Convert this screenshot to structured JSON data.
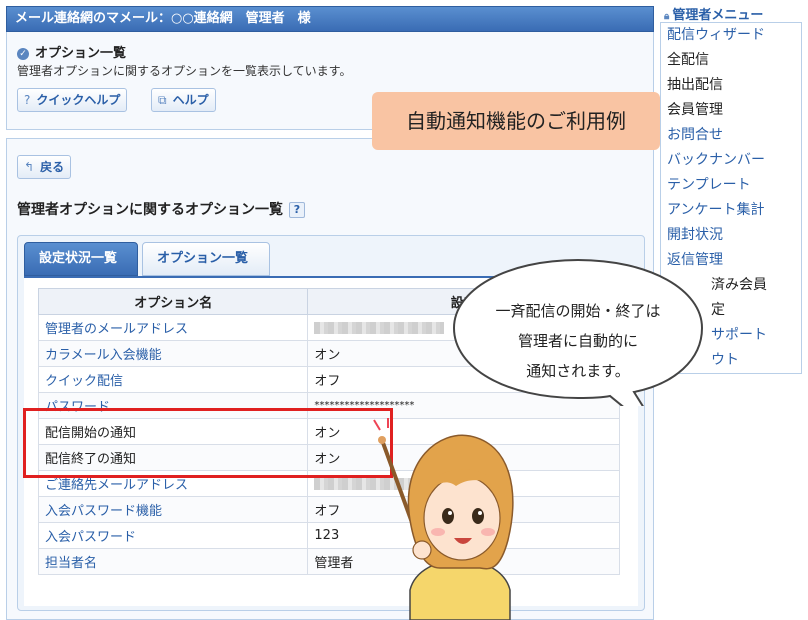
{
  "header": {
    "title": "メール連絡網のマメール：○○連絡網　管理者　様"
  },
  "summary": {
    "title": "オプション一覧",
    "description": "管理者オプションに関するオプションを一覧表示しています。",
    "quick_help_label": "クイックヘルプ",
    "help_label": "ヘルプ"
  },
  "callout": {
    "label": "自動通知機能のご利用例"
  },
  "main": {
    "back_label": "戻る",
    "section_title": "管理者オプションに関するオプション一覧",
    "tabs": [
      {
        "label": "設定状況一覧",
        "active": true
      },
      {
        "label": "オプション一覧",
        "active": false
      }
    ],
    "table": {
      "headers": [
        "オプション名",
        "設定"
      ],
      "rows": [
        {
          "name": "管理者のメールアドレス",
          "value": "",
          "blurred": true,
          "link": true
        },
        {
          "name": "カラメール入会機能",
          "value": "オン",
          "link": true
        },
        {
          "name": "クイック配信",
          "value": "オフ",
          "link": true
        },
        {
          "name": "パスワード",
          "value": "********************",
          "link": true
        },
        {
          "name": "配信開始の通知",
          "value": "オン",
          "link": false
        },
        {
          "name": "配信終了の通知",
          "value": "オン",
          "link": false
        },
        {
          "name": "ご連絡先メールアドレス",
          "value": "",
          "blurred": true,
          "link": true
        },
        {
          "name": "入会パスワード機能",
          "value": "オフ",
          "link": true
        },
        {
          "name": "入会パスワード",
          "value": "123",
          "link": true
        },
        {
          "name": "担当者名",
          "value": "管理者",
          "link": true
        }
      ]
    }
  },
  "menu": {
    "title": "管理者メニュー",
    "items": [
      {
        "label": "配信ウィザード",
        "link": true
      },
      {
        "label": "全配信",
        "link": false
      },
      {
        "label": "抽出配信",
        "link": false
      },
      {
        "label": "会員管理",
        "link": false
      },
      {
        "label": "お問合せ",
        "link": true
      },
      {
        "label": "バックナンバー",
        "link": true
      },
      {
        "label": "テンプレート",
        "link": true
      },
      {
        "label": "アンケート集計",
        "link": true
      },
      {
        "label": "開封状況",
        "link": true
      },
      {
        "label": "返信管理",
        "link": true
      },
      {
        "label": "済み会員",
        "link": false
      },
      {
        "label": "定",
        "link": false
      },
      {
        "label": "サポート",
        "link": true
      },
      {
        "label": "ウト",
        "link": true
      }
    ]
  },
  "bubble": {
    "line1": "一斉配信の開始・終了は",
    "line2": "管理者に自動的に",
    "line3": "通知されます。"
  },
  "colors": {
    "accent": "#3a6cb4",
    "highlight": "#e02020",
    "callout": "#f9c4a3"
  }
}
